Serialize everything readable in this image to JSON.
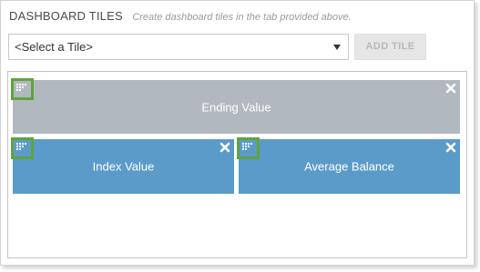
{
  "header": {
    "title": "DASHBOARD TILES",
    "description": "Create dashboard tiles in the tab provided above."
  },
  "tile_select": {
    "selected": "<Select a Tile>"
  },
  "add_button": {
    "label": "ADD TILE"
  },
  "tiles": [
    {
      "label": "Ending Value",
      "color": "#b1b8c0"
    },
    {
      "label": "Index Value",
      "color": "#5b9bc9"
    },
    {
      "label": "Average Balance",
      "color": "#5b9bc9"
    }
  ],
  "colors": {
    "highlight": "#62a33c",
    "disabled_button": "#e6e6e6"
  },
  "icons": {
    "drag_handle": "drag-handle-icon",
    "close": "close-icon",
    "dropdown": "chevron-down-icon"
  }
}
